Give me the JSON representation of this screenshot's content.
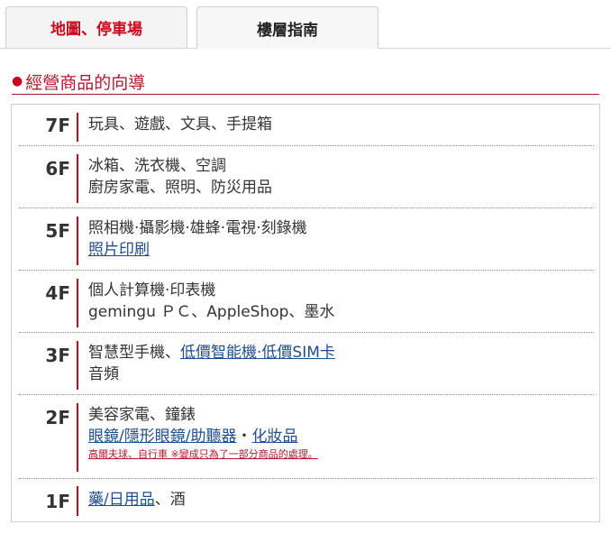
{
  "tabs": [
    {
      "label": "地圖、停車場",
      "active": false
    },
    {
      "label": "樓層指南",
      "active": true
    }
  ],
  "section": {
    "bullet": "●",
    "title": "經營商品的向導"
  },
  "floors": {
    "f7": {
      "floor": "7F",
      "line1": "玩具、遊戲、文具、手提箱"
    },
    "f6": {
      "floor": "6F",
      "line1": "冰箱、洗衣機、空調",
      "line2": "廚房家電、照明、防災用品"
    },
    "f5": {
      "floor": "5F",
      "line1": "照相機·攝影機·雄蜂·電視·刻錄機",
      "link1": "照片印刷"
    },
    "f4": {
      "floor": "4F",
      "line1": "個人計算機·印表機",
      "line2": "gemingu ＰＣ、AppleShop、墨水"
    },
    "f3": {
      "floor": "3F",
      "text1": "智慧型手機、",
      "link1": "低價智能機·低價SIM卡",
      "line2": "音頻"
    },
    "f2": {
      "floor": "2F",
      "line1": "美容家電、鐘錶",
      "link1": "眼鏡/隱形眼鏡/助聽器",
      "sep": "・",
      "link2": "化妝品",
      "note": "高爾夫球、自行車 ※變成只為了一部分商品的處理。"
    },
    "f1": {
      "floor": "1F",
      "link1": "藥/日用品",
      "text1": "、酒"
    }
  },
  "colors": {
    "accent": "#c9081c",
    "link": "#1e4e8c"
  }
}
